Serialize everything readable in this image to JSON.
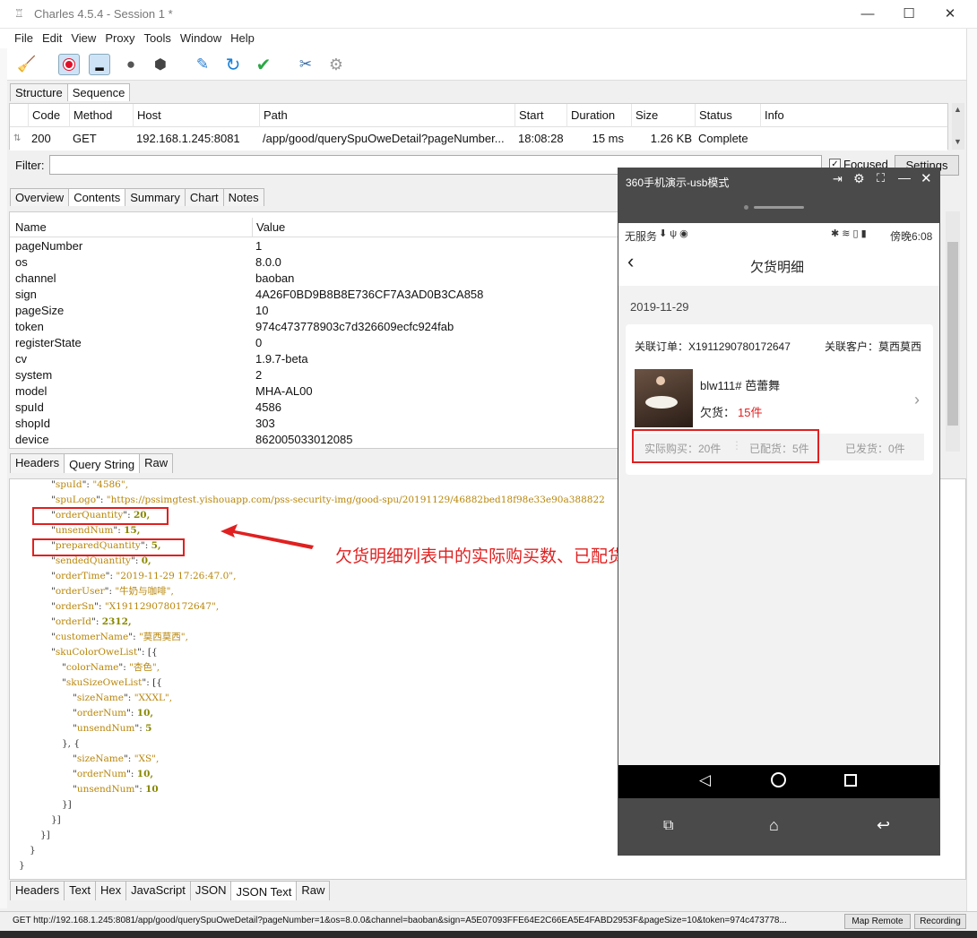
{
  "window": {
    "title": "Charles 4.5.4 - Session 1 *"
  },
  "menu": [
    "File",
    "Edit",
    "View",
    "Proxy",
    "Tools",
    "Window",
    "Help"
  ],
  "top_tabs": [
    "Structure",
    "Sequence"
  ],
  "seq": {
    "headers": [
      "Code",
      "Method",
      "Host",
      "Path",
      "Start",
      "Duration",
      "Size",
      "Status",
      "Info"
    ],
    "row": [
      "200",
      "GET",
      "192.168.1.245:8081",
      "/app/good/querySpuOweDetail?pageNumber...",
      "18:08:28",
      "15 ms",
      "1.26 KB",
      "Complete",
      ""
    ]
  },
  "filter": {
    "label": "Filter:",
    "focused": "Focused",
    "settings": "Settings"
  },
  "detail_tabs": [
    "Overview",
    "Contents",
    "Summary",
    "Chart",
    "Notes"
  ],
  "kv": {
    "headers": [
      "Name",
      "Value"
    ],
    "rows": [
      [
        "pageNumber",
        "1"
      ],
      [
        "os",
        "8.0.0"
      ],
      [
        "channel",
        "baoban"
      ],
      [
        "sign",
        "4A26F0BD9B8B8E736CF7A3AD0B3CA858"
      ],
      [
        "pageSize",
        "10"
      ],
      [
        "token",
        "974c473778903c7d326609ecfc924fab"
      ],
      [
        "registerState",
        "0"
      ],
      [
        "cv",
        "1.9.7-beta"
      ],
      [
        "system",
        "2"
      ],
      [
        "model",
        "MHA-AL00"
      ],
      [
        "spuId",
        "4586"
      ],
      [
        "shopId",
        "303"
      ],
      [
        "device",
        "862005033012085"
      ]
    ]
  },
  "req_tabs": [
    "Headers",
    "Query String",
    "Raw"
  ],
  "resp_tabs": [
    "Headers",
    "Text",
    "Hex",
    "JavaScript",
    "JSON",
    "JSON Text",
    "Raw"
  ],
  "json_lines": [
    {
      "i": 3,
      "k": "spuId",
      "v": "\"4586\",",
      "t": "s"
    },
    {
      "i": 3,
      "k": "spuLogo",
      "v": "\"https://pssimgtest.yishouapp.com/pss-security-img/good-spu/20191129/46882bed18f98e33e90a388822",
      "t": "s"
    },
    {
      "i": 3,
      "k": "orderQuantity",
      "v": "20,",
      "t": "n"
    },
    {
      "i": 3,
      "k": "unsendNum",
      "v": "15,",
      "t": "n"
    },
    {
      "i": 3,
      "k": "preparedQuantity",
      "v": "5,",
      "t": "n"
    },
    {
      "i": 3,
      "k": "sendedQuantity",
      "v": "0,",
      "t": "n"
    },
    {
      "i": 3,
      "k": "orderTime",
      "v": "\"2019-11-29 17:26:47.0\",",
      "t": "s"
    },
    {
      "i": 3,
      "k": "orderUser",
      "v": "\"牛奶与咖啡\",",
      "t": "s"
    },
    {
      "i": 3,
      "k": "orderSn",
      "v": "\"X1911290780172647\",",
      "t": "s"
    },
    {
      "i": 3,
      "k": "orderId",
      "v": "2312,",
      "t": "n"
    },
    {
      "i": 3,
      "k": "customerName",
      "v": "\"莫西莫西\",",
      "t": "s"
    },
    {
      "i": 3,
      "k": "skuColorOweList",
      "v": "[{",
      "t": "p"
    },
    {
      "i": 4,
      "k": "colorName",
      "v": "\"杏色\",",
      "t": "s"
    },
    {
      "i": 4,
      "k": "skuSizeOweList",
      "v": "[{",
      "t": "p"
    },
    {
      "i": 5,
      "k": "sizeName",
      "v": "\"XXXL\",",
      "t": "s"
    },
    {
      "i": 5,
      "k": "orderNum",
      "v": "10,",
      "t": "n"
    },
    {
      "i": 5,
      "k": "unsendNum",
      "v": "5",
      "t": "n"
    },
    {
      "i": 4,
      "k": "",
      "v": "}, {",
      "t": "p"
    },
    {
      "i": 5,
      "k": "sizeName",
      "v": "\"XS\",",
      "t": "s"
    },
    {
      "i": 5,
      "k": "orderNum",
      "v": "10,",
      "t": "n"
    },
    {
      "i": 5,
      "k": "unsendNum",
      "v": "10",
      "t": "n"
    },
    {
      "i": 4,
      "k": "",
      "v": "}]",
      "t": "p"
    },
    {
      "i": 3,
      "k": "",
      "v": "}]",
      "t": "p"
    },
    {
      "i": 2,
      "k": "",
      "v": "}]",
      "t": "p"
    },
    {
      "i": 1,
      "k": "",
      "v": "}",
      "t": "p"
    },
    {
      "i": 0,
      "k": "",
      "v": "}",
      "t": "p"
    }
  ],
  "annotation": "欠货明细列表中的实际购买数、已配货数不正确",
  "status_url": "GET http://192.168.1.245:8081/app/good/querySpuOweDetail?pageNumber=1&os=8.0.0&channel=baoban&sign=A5E07093FFE64E2C66EA5E4FABD2953F&pageSize=10&token=974c473778...",
  "status_buttons": [
    "Map Remote",
    "Recording"
  ],
  "phone": {
    "window_title": "360手机演示-usb模式",
    "status_left": "无服务",
    "status_right": "傍晚6:08",
    "page_title": "欠货明细",
    "date": "2019-11-29",
    "order_label": "关联订单：X1911290780172647",
    "customer_label": "关联客户：莫西莫西",
    "product_name": "blw111# 芭蕾舞",
    "owe_label": "欠货：",
    "owe_value": "15件",
    "bought": "实际购买：20件",
    "prepared": "已配货：5件",
    "sent": "已发货：0件"
  },
  "colors": {
    "accent_red": "#e02020",
    "phone_bg": "#4a4a4a"
  }
}
